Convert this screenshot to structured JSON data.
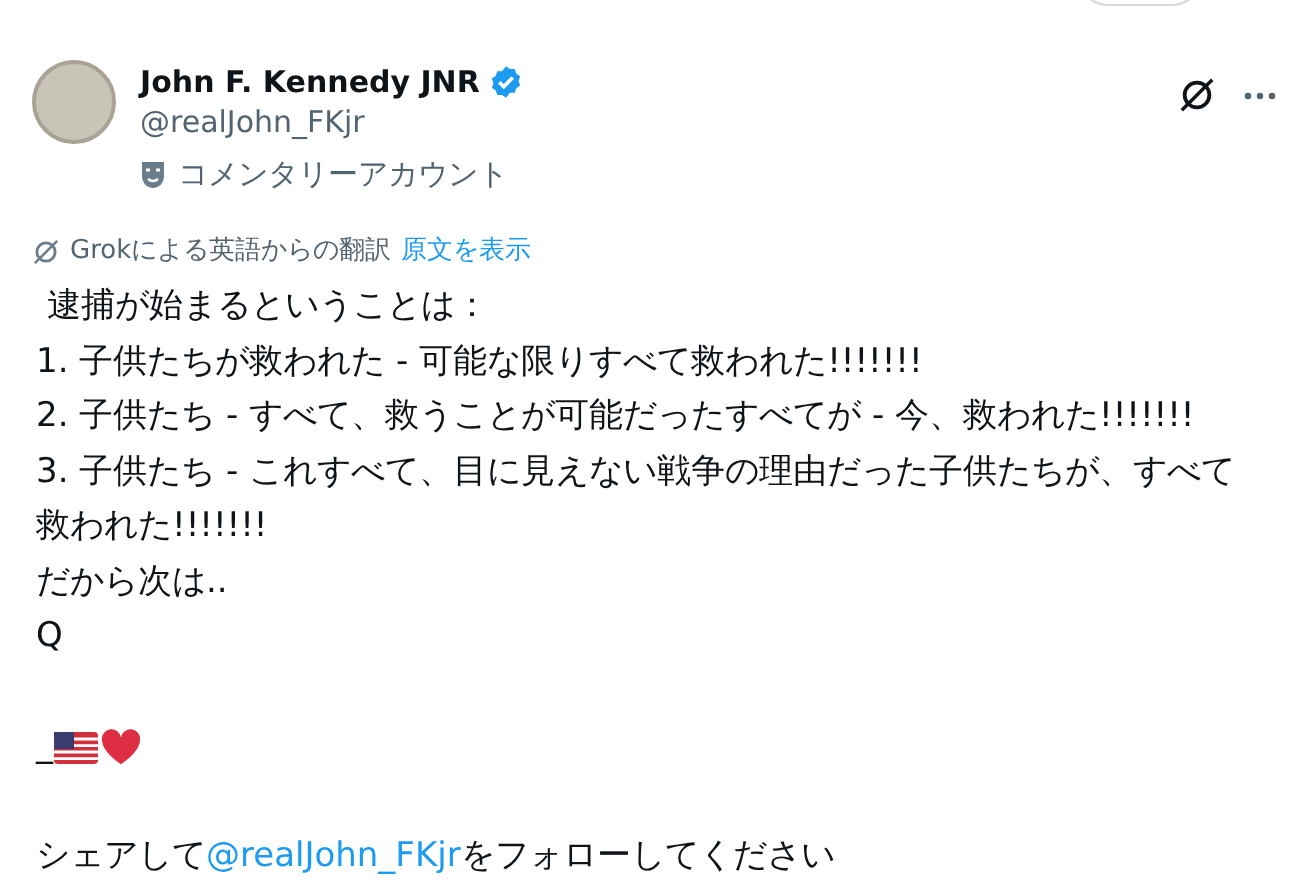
{
  "author": {
    "name": "John F. Kennedy JNR",
    "verified": true,
    "handle": "@realJohn_FKjr",
    "label": "コメンタリーアカウント"
  },
  "translation": {
    "note": "Grokによる英語からの翻訳",
    "link": "原文を表示"
  },
  "body": {
    "lines": [
      " 逮捕が始まるということは：",
      "1. 子供たちが救われた - 可能な限りすべて救われた!!!!!!!",
      "2. 子供たち - すべて、救うことが可能だったすべてが - 今、救われた!!!!!!!",
      "3. 子供たち - これすべて、目に見えない戦争の理由だった子供たちが、すべて救われた!!!!!!!",
      "だから次は..",
      "Q"
    ],
    "emoji_line": "_",
    "closing": {
      "before": "シェアして",
      "mention": "@realJohn_FKjr",
      "after": "をフォローしてください"
    }
  }
}
